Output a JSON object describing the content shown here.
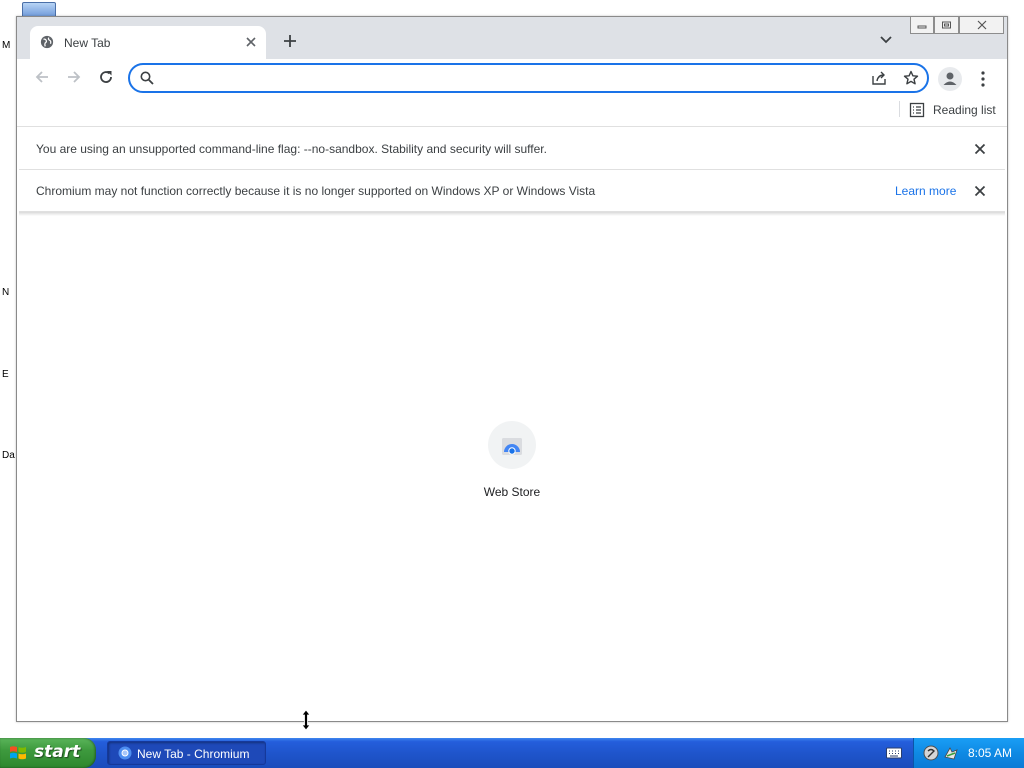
{
  "browser": {
    "tab": {
      "title": "New Tab"
    },
    "omnibox": {
      "value": "",
      "placeholder": ""
    },
    "bookmarks_bar": {
      "reading_list_label": "Reading list"
    },
    "infobars": [
      {
        "text": "You are using an unsupported command-line flag: --no-sandbox. Stability and security will suffer.",
        "link": ""
      },
      {
        "text": "Chromium may not function correctly because it is no longer supported on Windows XP or Windows Vista",
        "link": "Learn more"
      }
    ],
    "shortcuts": [
      {
        "label": "Web Store",
        "icon": "web-store-icon"
      }
    ],
    "accent_color": "#1a73e8"
  },
  "taskbar": {
    "start_label": "start",
    "items": [
      {
        "label": "New Tab - Chromium",
        "icon": "chromium-icon"
      }
    ],
    "clock": "8:05 AM"
  },
  "desktop": {
    "icon_labels": [
      "M",
      "N",
      "E",
      "Da"
    ]
  }
}
